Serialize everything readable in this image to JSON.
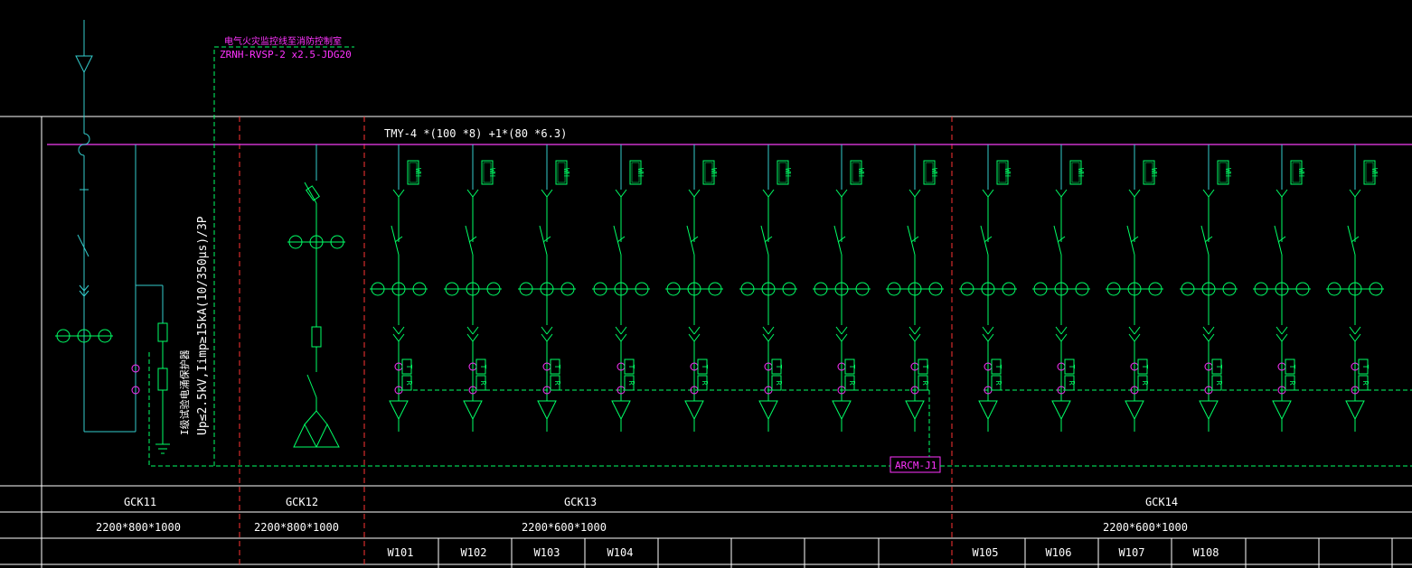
{
  "cable_note": {
    "title": "电气火灾监控线至消防控制室",
    "spec": "ZRNH-RVSP-2 x2.5-JDG20"
  },
  "busbar_label": "TMY-4 *(100 *8)  +1*(80 *6.3)",
  "surge_protector": {
    "name": "I级试验电涌保护器",
    "spec": "Up≤2.5kV,Iimp≥15kA(10/350μs)/3P"
  },
  "monitor_box": "ARCM-J1",
  "breaker_tag": "WH",
  "ct_tag": "T",
  "residual_tag": "R",
  "panels": [
    {
      "name": "GCK11",
      "size": "2200*800*1000"
    },
    {
      "name": "GCK12",
      "size": "2200*800*1000"
    },
    {
      "name": "GCK13",
      "size": "2200*600*1000"
    },
    {
      "name": "GCK14",
      "size": "2200*600*1000"
    }
  ],
  "circuits": [
    "W101",
    "W102",
    "W103",
    "W104",
    "W105",
    "W106",
    "W107",
    "W108"
  ],
  "colors": {
    "background": "#000000",
    "table_lines": "#ffffff",
    "text": "#ffffff",
    "busbar": "#cc33cc",
    "feeder": "#00ff66",
    "incoming": "#33cccc",
    "magenta": "#ff33ff",
    "panel_divider": "#ff3333"
  }
}
